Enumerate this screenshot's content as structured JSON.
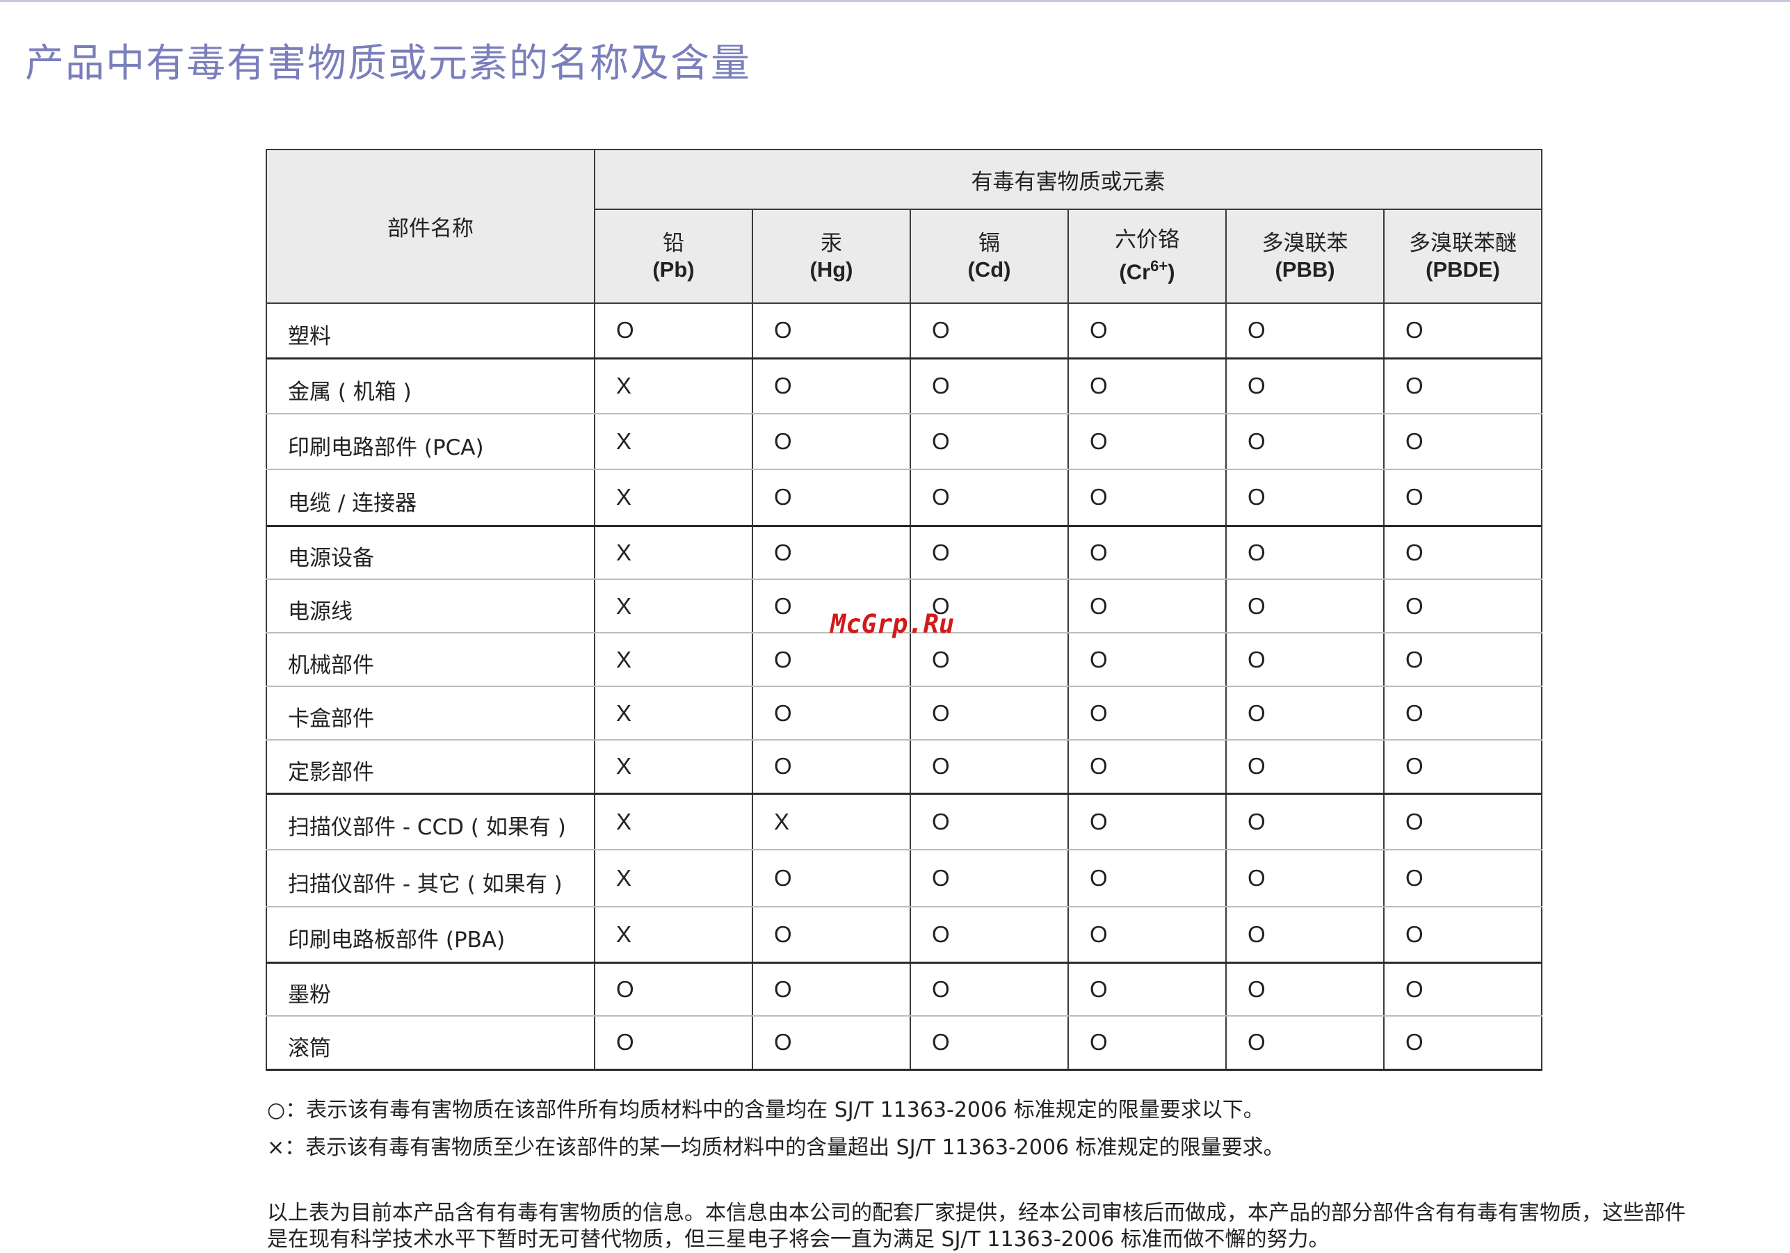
{
  "page": {
    "title": "产品中有毒有害物质或元素的名称及含量",
    "watermark": "McGrp.Ru"
  },
  "table": {
    "part_header": "部件名称",
    "group_header": "有毒有害物质或元素",
    "substances": [
      {
        "cn": "铅",
        "en": "(Pb)"
      },
      {
        "cn": "汞",
        "en": "(Hg)"
      },
      {
        "cn": "镉",
        "en": "(Cd)"
      },
      {
        "cn": "六价铬",
        "en_pre": "(Cr",
        "en_sup": "6+",
        "en_post": ")"
      },
      {
        "cn": "多溴联苯",
        "en": "(PBB)"
      },
      {
        "cn": "多溴联苯醚",
        "en": "(PBDE)"
      }
    ],
    "rows": [
      {
        "part": "塑料",
        "values": [
          "O",
          "O",
          "O",
          "O",
          "O",
          "O"
        ]
      },
      {
        "part": "金属 ( 机箱 )",
        "values": [
          "X",
          "O",
          "O",
          "O",
          "O",
          "O"
        ]
      },
      {
        "part": "印刷电路部件 (PCA)",
        "values": [
          "X",
          "O",
          "O",
          "O",
          "O",
          "O"
        ]
      },
      {
        "part": "电缆 / 连接器",
        "values": [
          "X",
          "O",
          "O",
          "O",
          "O",
          "O"
        ]
      },
      {
        "part": "电源设备",
        "values": [
          "X",
          "O",
          "O",
          "O",
          "O",
          "O"
        ]
      },
      {
        "part": "电源线",
        "values": [
          "X",
          "O",
          "O",
          "O",
          "O",
          "O"
        ]
      },
      {
        "part": "机械部件",
        "values": [
          "X",
          "O",
          "O",
          "O",
          "O",
          "O"
        ]
      },
      {
        "part": "卡盒部件",
        "values": [
          "X",
          "O",
          "O",
          "O",
          "O",
          "O"
        ]
      },
      {
        "part": "定影部件",
        "values": [
          "X",
          "O",
          "O",
          "O",
          "O",
          "O"
        ]
      },
      {
        "part": "扫描仪部件 - CCD ( 如果有 )",
        "values": [
          "X",
          "X",
          "O",
          "O",
          "O",
          "O"
        ]
      },
      {
        "part": "扫描仪部件 - 其它 ( 如果有 )",
        "values": [
          "X",
          "O",
          "O",
          "O",
          "O",
          "O"
        ]
      },
      {
        "part": "印刷电路板部件 (PBA)",
        "values": [
          "X",
          "O",
          "O",
          "O",
          "O",
          "O"
        ]
      },
      {
        "part": "墨粉",
        "values": [
          "O",
          "O",
          "O",
          "O",
          "O",
          "O"
        ]
      },
      {
        "part": "滚筒",
        "values": [
          "O",
          "O",
          "O",
          "O",
          "O",
          "O"
        ]
      }
    ]
  },
  "notes": {
    "o_symbol": "○",
    "o_text": "：表示该有毒有害物质在该部件所有均质材料中的含量均在 SJ/T 11363-2006 标准规定的限量要求以下。",
    "x_symbol": "×",
    "x_text": "：表示该有毒有害物质至少在该部件的某一均质材料中的含量超出 SJ/T 11363-2006 标准规定的限量要求。"
  },
  "footer": {
    "text": "以上表为目前本产品含有有毒有害物质的信息。本信息由本公司的配套厂家提供，经本公司审核后而做成，本产品的部分部件含有有毒有害物质，这些部件是在现有科学技术水平下暂时无可替代物质，但三星电子将会一直为满足 SJ/T 11363-2006 标准而做不懈的努力。"
  }
}
